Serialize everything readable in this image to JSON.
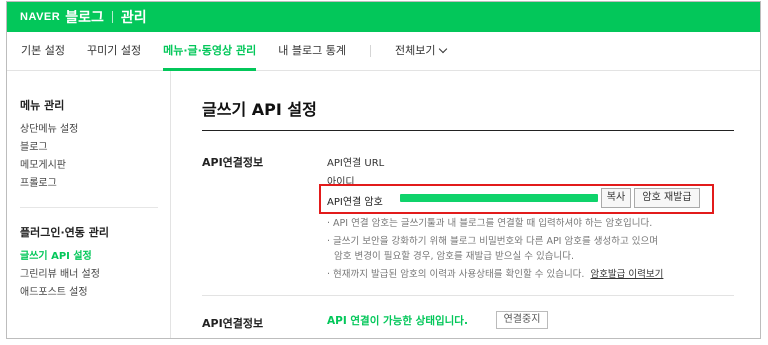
{
  "header": {
    "brand": "NAVER",
    "blog": "블로그",
    "admin": "관리",
    "accent_color": "#03c75a"
  },
  "tabs": [
    {
      "label": "기본 설정"
    },
    {
      "label": "꾸미기 설정"
    },
    {
      "label": "메뉴·글·동영상 관리"
    },
    {
      "label": "내 블로그 통계"
    },
    {
      "label": "전체보기"
    }
  ],
  "sidebar": {
    "menu_title": "메뉴 관리",
    "menu_items": [
      "상단메뉴 설정",
      "블로그",
      "메모게시판",
      "프롤로그"
    ],
    "plugin_title": "플러그인·연동 관리",
    "plugin_items": [
      "글쓰기 API 설정",
      "그린리뷰 배너 설정",
      "애드포스트 설정"
    ]
  },
  "main": {
    "title": "글쓰기 API 설정",
    "section1_label": "API연결정보",
    "url_label": "API연결 URL",
    "id_label": "아이디",
    "pw_label": "API연결 암호",
    "copy_button": "복사",
    "reissue_button": "암호 재발급",
    "notes": [
      "· API 연결 암호는 글쓰기툴과 내 블로그를 연결할 때 입력하셔야 하는 암호입니다.",
      "· 글쓰기 보안을 강화하기 위해 블로그 비밀번호와 다른 API 암호를 생성하고 있으며",
      "암호 변경이 필요할 경우, 암호를 재발급 받으실 수 있습니다.",
      "· 현재까지 발급된 암호의 이력과 사용상태를 확인할 수 있습니다."
    ],
    "history_link": "암호발급 이력보기",
    "section2_label": "API연결정보",
    "status_text": "API 연결이 가능한 상태입니다.",
    "stop_button": "연결중지"
  }
}
